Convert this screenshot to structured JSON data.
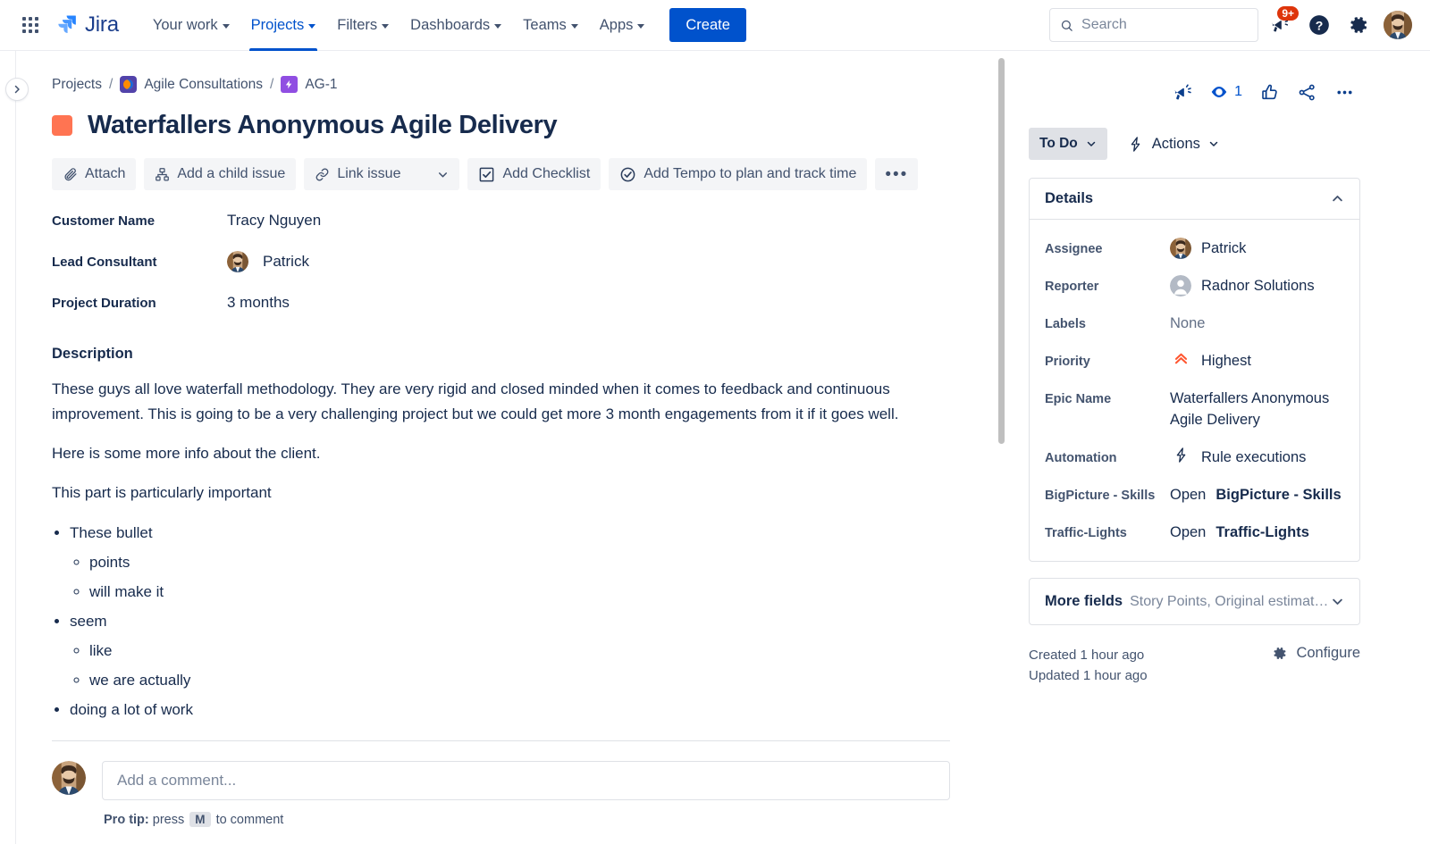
{
  "topnav": {
    "app_switcher_icon": "app-switcher-icon",
    "brand": "Jira",
    "items": [
      {
        "label": "Your work",
        "has_caret": true,
        "active": false
      },
      {
        "label": "Projects",
        "has_caret": true,
        "active": true
      },
      {
        "label": "Filters",
        "has_caret": true,
        "active": false
      },
      {
        "label": "Dashboards",
        "has_caret": true,
        "active": false
      },
      {
        "label": "Teams",
        "has_caret": true,
        "active": false
      },
      {
        "label": "Apps",
        "has_caret": true,
        "active": false
      }
    ],
    "create_label": "Create",
    "search_placeholder": "Search",
    "notifications_badge": "9+",
    "icons": [
      "notifications-icon",
      "help-icon",
      "settings-icon",
      "profile-avatar"
    ]
  },
  "breadcrumb": {
    "projects_label": "Projects",
    "separator": "/",
    "project_label": "Agile Consultations",
    "issue_key": "AG-1"
  },
  "issue": {
    "title": "Waterfallers Anonymous Agile Delivery"
  },
  "actionbar": {
    "attach": "Attach",
    "add_child_issue": "Add a child issue",
    "link_issue": "Link issue",
    "add_checklist": "Add Checklist",
    "add_tempo": "Add Tempo to plan and track time",
    "more": "•••"
  },
  "fields": [
    {
      "label": "Customer Name",
      "value": "Tracy Nguyen",
      "avatar": false
    },
    {
      "label": "Lead Consultant",
      "value": "Patrick",
      "avatar": true
    },
    {
      "label": "Project Duration",
      "value": "3 months",
      "avatar": false
    }
  ],
  "description": {
    "heading": "Description",
    "paragraphs": [
      "These guys all love waterfall methodology. They are very rigid and closed minded when it comes to feedback and continuous improvement. This is going to be a very challenging project but we could get more 3 month engagements from it if it goes well.",
      "Here is some more info about the client.",
      "This part is particularly important"
    ],
    "bullets": [
      {
        "text": "These bullet",
        "children": [
          "points",
          "will make it"
        ]
      },
      {
        "text": "seem",
        "children": [
          "like",
          "we are actually"
        ]
      },
      {
        "text": "doing a lot of work",
        "children": []
      }
    ]
  },
  "comment": {
    "placeholder": "Add a comment...",
    "protip_prefix": "Pro tip:",
    "protip_mid": "press",
    "protip_key": "M",
    "protip_suffix": "to comment"
  },
  "sidepanel": {
    "icons": [
      "feedback-megaphone-icon",
      "watch-eye-icon",
      "like-thumbsup-icon",
      "share-icon",
      "more-options-icon"
    ],
    "watch_count": "1",
    "status": "To Do",
    "actions_label": "Actions",
    "details_heading": "Details",
    "details": [
      {
        "label": "Assignee",
        "value": "Patrick",
        "kind": "user-avatar"
      },
      {
        "label": "Reporter",
        "value": "Radnor Solutions",
        "kind": "generic-avatar"
      },
      {
        "label": "Labels",
        "value": "None",
        "kind": "muted"
      },
      {
        "label": "Priority",
        "value": "Highest",
        "kind": "priority-highest"
      },
      {
        "label": "Epic Name",
        "value": "Waterfallers Anonymous Agile Delivery",
        "kind": "text"
      },
      {
        "label": "Automation",
        "value": "Rule executions",
        "kind": "automation-bolt"
      },
      {
        "label": "BigPicture - Skills",
        "value_prefix": "Open ",
        "value_bold": "BigPicture - Skills",
        "kind": "link"
      },
      {
        "label": "Traffic-Lights",
        "value_prefix": "Open ",
        "value_bold": "Traffic-Lights",
        "kind": "link"
      }
    ],
    "more_fields_title": "More fields",
    "more_fields_sub": "Story Points, Original estimate, ...",
    "created": "Created 1 hour ago",
    "updated": "Updated 1 hour ago",
    "configure": "Configure"
  },
  "colors": {
    "brand_blue": "#0052CC",
    "badge_red": "#DE350B",
    "epic_purple": "#904EE2",
    "title_chip_orange": "#FF7452",
    "priority_orange": "#FF5630",
    "text": "#172B4D"
  }
}
